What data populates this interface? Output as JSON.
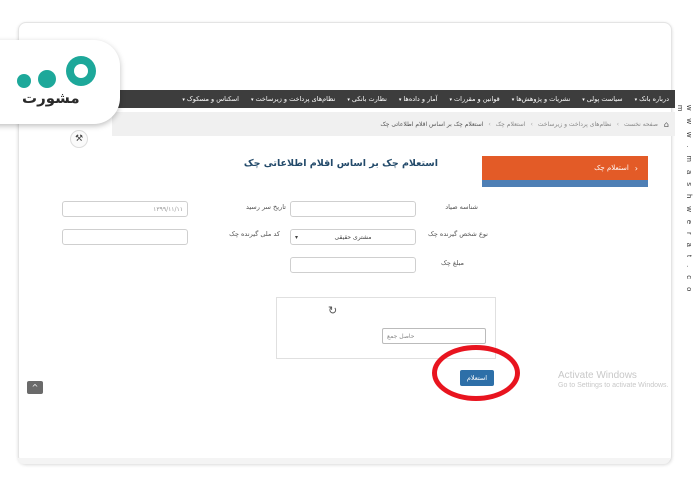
{
  "navbar": {
    "items": [
      {
        "label": "درباره بانک"
      },
      {
        "label": "سیاست پولی"
      },
      {
        "label": "نشریات و پژوهش‌ها"
      },
      {
        "label": "قوانین و مقررات"
      },
      {
        "label": "آمار و داده‌ها"
      },
      {
        "label": "نظارت بانکی"
      },
      {
        "label": "نظام‌های پرداخت و زیرساخت"
      },
      {
        "label": "اسکناس و مسکوک"
      }
    ]
  },
  "breadcrumb": {
    "items": [
      "صفحه نخست",
      "نظام‌های پرداخت و زیرساخت",
      "استعلام چک",
      "استعلام چک بر اساس اقلام اطلاعاتی چک"
    ]
  },
  "sidebar": {
    "active_label": "استعلام چک"
  },
  "page": {
    "title": "استعلام چک بر اساس اقلام اطلاعاتی چک"
  },
  "form": {
    "sayad_label": "شناسه صیاد",
    "issue_date_label": "تاریخ سر رسید",
    "issue_date_placeholder": "۱۳۹۹/۱۱/۱۱",
    "receiver_type_label": "نوع شخص گیرنده چک",
    "receiver_type_value": "مشتری حقیقی",
    "national_id_label": "کد ملی گیرنده چک",
    "amount_label": "مبلغ چک"
  },
  "captcha": {
    "placeholder": "حاصل جمع"
  },
  "submit_label": "استعلام",
  "watermark": {
    "line1": "Activate Windows",
    "line2": "Go to Settings to activate Windows."
  },
  "vertical_url": "w w w . m a s h w e r a t . c o m",
  "logo": {
    "text": "مشورت"
  },
  "colors": {
    "navbar": "#3d3d3d",
    "side_button": "#e35b27",
    "submit": "#2d6fa8",
    "highlight": "#e8141f",
    "logo": "#1da89a"
  }
}
